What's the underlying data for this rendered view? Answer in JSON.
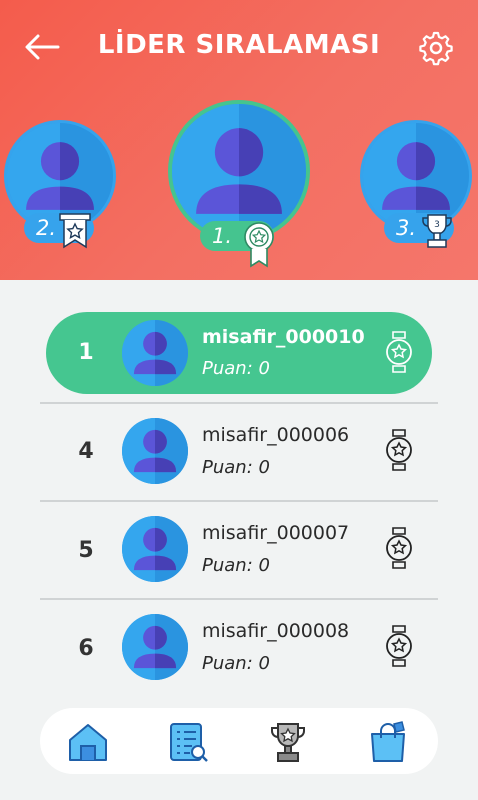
{
  "header": {
    "title": "LİDER SIRALAMASI"
  },
  "podium": [
    {
      "rank_label": "2.",
      "place": 2
    },
    {
      "rank_label": "1.",
      "place": 1
    },
    {
      "rank_label": "3.",
      "place": 3
    }
  ],
  "rows": [
    {
      "rank": "1",
      "username": "misafir_000010",
      "score": "Puan: 0",
      "highlighted": true
    },
    {
      "rank": "4",
      "username": "misafir_000006",
      "score": "Puan: 0"
    },
    {
      "rank": "5",
      "username": "misafir_000007",
      "score": "Puan: 0"
    },
    {
      "rank": "6",
      "username": "misafir_000008",
      "score": "Puan: 0"
    }
  ],
  "nav": [
    "home-icon",
    "leaderboard-list-icon",
    "trophy-icon",
    "shopping-bag-icon"
  ],
  "colors": {
    "header": "#f45c4c",
    "highlight": "#45c690",
    "avatar": "#2ea0ec",
    "avatar_dark": "#5148c8"
  }
}
